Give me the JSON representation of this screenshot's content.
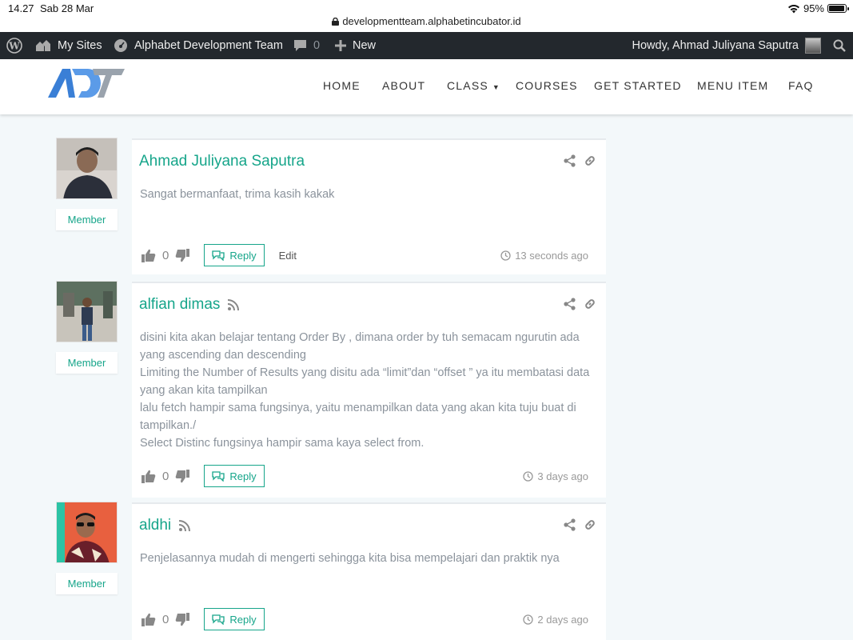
{
  "status_bar": {
    "time": "14.27",
    "date": "Sab 28 Mar",
    "url": "developmentteam.alphabetincubator.id",
    "battery": "95%",
    "battery_level": 0.95
  },
  "admin_bar": {
    "my_sites": "My Sites",
    "site_name": "Alphabet Development Team",
    "comments_count": "0",
    "new_label": "New",
    "howdy": "Howdy, Ahmad Juliyana Saputra"
  },
  "nav": {
    "items": [
      {
        "label": "HOME"
      },
      {
        "label": "ABOUT"
      },
      {
        "label": "CLASS"
      },
      {
        "label": "COURSES"
      },
      {
        "label": "GET STARTED"
      },
      {
        "label": "MENU ITEM"
      },
      {
        "label": "FAQ"
      }
    ]
  },
  "colors": {
    "accent": "#16a58a",
    "admin_bar": "#23282d",
    "background": "#f3f8fa",
    "body_text": "#8b939c"
  },
  "icons": [
    "wordpress-icon",
    "my-sites-icon",
    "dashboard-icon",
    "comment-bubble-icon",
    "plus-icon",
    "search-icon",
    "share-icon",
    "link-icon",
    "rss-icon",
    "thumbs-up-icon",
    "thumbs-down-icon",
    "reply-icon",
    "clock-icon",
    "lock-icon",
    "wifi-icon"
  ],
  "comments": [
    {
      "author": "Ahmad Juliyana Saputra",
      "badge": "Member",
      "lines": [
        "Sangat bermanfaat, trima kasih kakak"
      ],
      "votes": "0",
      "reply_label": "Reply",
      "edit_label": "Edit",
      "time": "13 seconds ago"
    },
    {
      "author": "alfian dimas",
      "badge": "Member",
      "lines": [
        "disini kita akan belajar tentang Order By , dimana order by tuh semacam ngurutin ada",
        "yang ascending dan descending",
        "Limiting the Number of Results yang disitu ada “limit”dan “offset ” ya itu membatasi data",
        "yang akan kita tampilkan",
        "lalu fetch hampir sama fungsinya, yaitu menampilkan data yang akan kita tuju buat di",
        "tampilkan./",
        "Select Distinc fungsinya hampir sama kaya select from."
      ],
      "votes": "0",
      "reply_label": "Reply",
      "time": "3 days ago"
    },
    {
      "author": "aldhi",
      "badge": "Member",
      "lines": [
        "Penjelasannya mudah di mengerti sehingga kita bisa mempelajari dan praktik nya"
      ],
      "votes": "0",
      "reply_label": "Reply",
      "time": "2 days ago"
    }
  ]
}
